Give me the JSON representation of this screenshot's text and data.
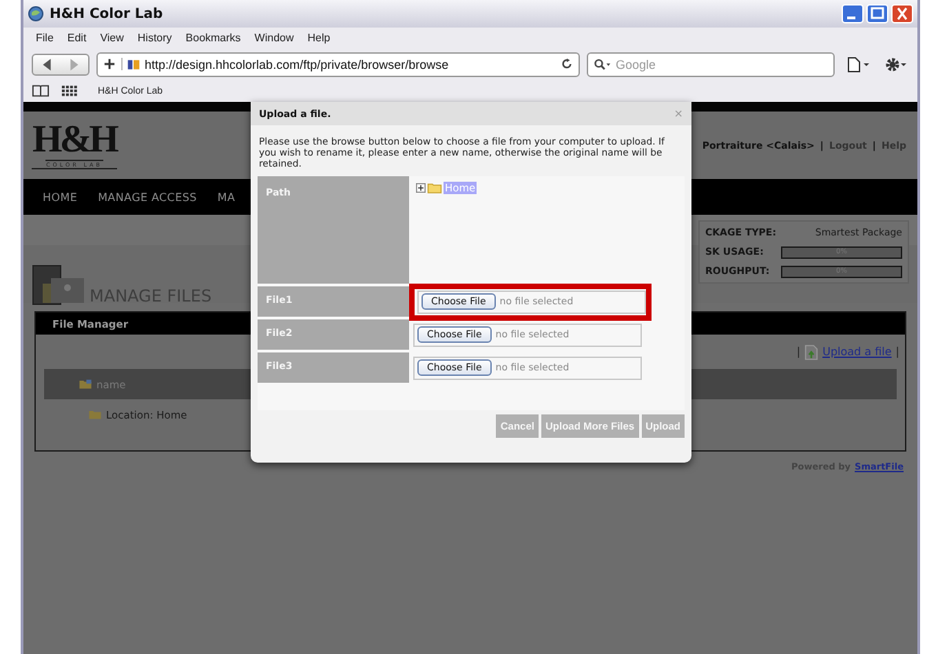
{
  "browser": {
    "title": "H&H Color Lab",
    "menu": [
      "File",
      "Edit",
      "View",
      "History",
      "Bookmarks",
      "Window",
      "Help"
    ],
    "address": "http://design.hhcolorlab.com/ftp/private/browser/browse",
    "search": {
      "placeholder": "Google"
    },
    "bookmarks": [
      "H&H Color Lab"
    ]
  },
  "page": {
    "logo": {
      "mark": "H&H",
      "tagline": "COLOR LAB"
    },
    "user_links": [
      "Portraiture <Calais>",
      "Logout",
      "Help"
    ],
    "separator": "|",
    "nav": [
      "HOME",
      "MANAGE ACCESS",
      "MA"
    ],
    "title": "MANAGE FILES",
    "stats": [
      {
        "kind": "text",
        "label": "CKAGE TYPE:",
        "value": "Smartest Package"
      },
      {
        "kind": "meter",
        "label": "SK USAGE:",
        "level": 0,
        "reading": "0%"
      },
      {
        "kind": "meter",
        "label": "ROUGHPUT:",
        "level": 0,
        "reading": "0%"
      }
    ],
    "file_manager": {
      "title": "File Manager",
      "upload_link": "Upload a file",
      "column": "name",
      "location": "Location: Home"
    },
    "footer": {
      "text": "Powered by",
      "link": "SmartFile"
    }
  },
  "dialog": {
    "title": "Upload a file.",
    "close": "×",
    "message": "Please use the browse button below to choose a file from your computer to upload. If you wish to rename it, please enter a new name, otherwise the original name will be retained.",
    "path": {
      "label": "Path",
      "tree": {
        "label": "Home",
        "selected": true,
        "expanded": false
      }
    },
    "files": [
      {
        "label": "File1",
        "button": "Choose File",
        "status": "no file selected",
        "highlighted": true
      },
      {
        "label": "File2",
        "button": "Choose File",
        "status": "no file selected",
        "highlighted": false
      },
      {
        "label": "File3",
        "button": "Choose File",
        "status": "no file selected",
        "highlighted": false
      }
    ],
    "buttons": [
      "Cancel",
      "Upload More Files",
      "Upload"
    ]
  }
}
